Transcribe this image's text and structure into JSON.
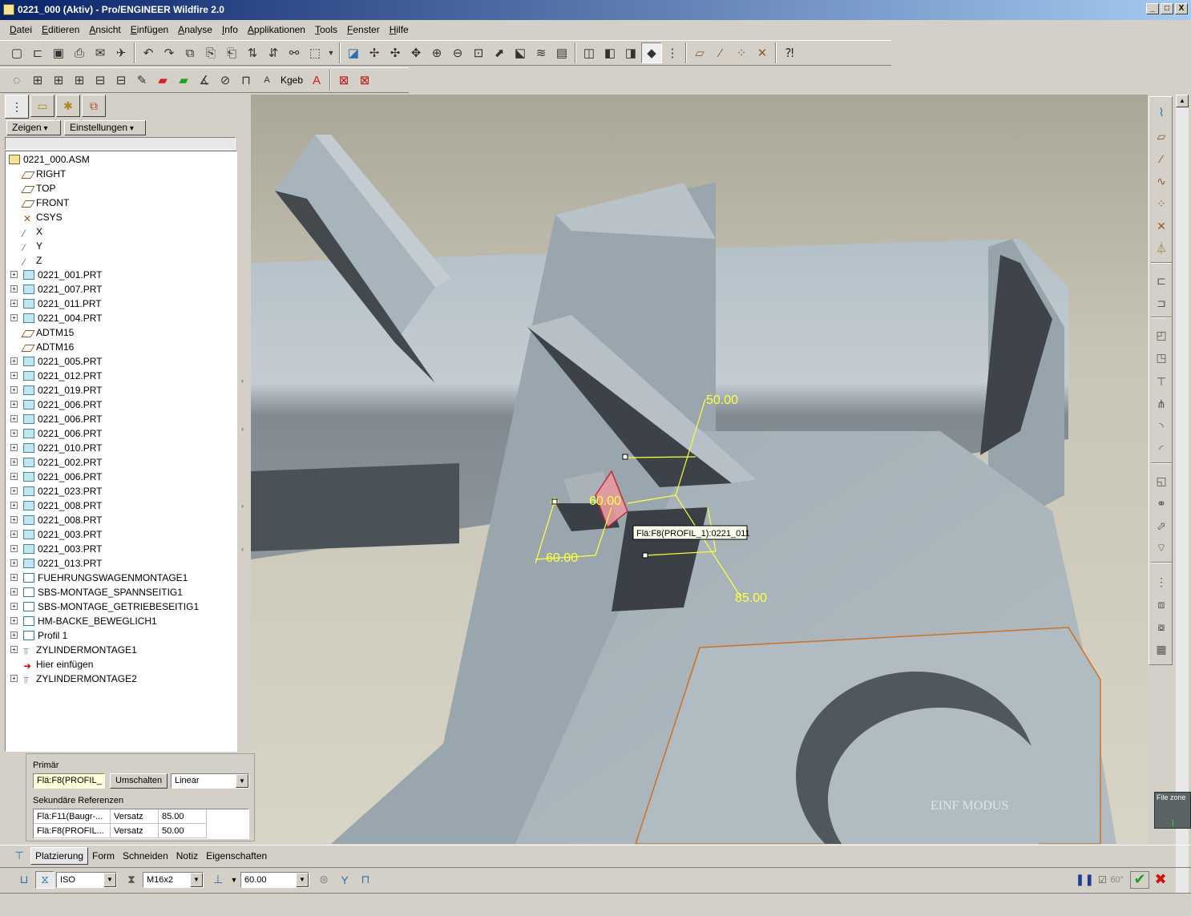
{
  "window": {
    "title": "0221_000 (Aktiv) - Pro/ENGINEER Wildfire 2.0",
    "buttons": [
      "_",
      "□",
      "X"
    ]
  },
  "menu": [
    "Datei",
    "Editieren",
    "Ansicht",
    "Einfügen",
    "Analyse",
    "Info",
    "Applikationen",
    "Tools",
    "Fenster",
    "Hilfe"
  ],
  "toolbar2": {
    "kgeb_label": "Kgeb"
  },
  "panel": {
    "show_button": "Zeigen",
    "settings_button": "Einstellungen"
  },
  "tree": [
    {
      "label": "0221_000.ASM",
      "type": "asm",
      "expand": false
    },
    {
      "label": "RIGHT",
      "type": "datum",
      "expand": false
    },
    {
      "label": "TOP",
      "type": "datum",
      "expand": false
    },
    {
      "label": "FRONT",
      "type": "datum",
      "expand": false
    },
    {
      "label": "CSYS",
      "type": "csys",
      "expand": false
    },
    {
      "label": "X",
      "type": "axis",
      "expand": false
    },
    {
      "label": "Y",
      "type": "axis",
      "expand": false
    },
    {
      "label": "Z",
      "type": "axis",
      "expand": false
    },
    {
      "label": "0221_001.PRT",
      "type": "prt",
      "expand": true
    },
    {
      "label": "0221_007.PRT",
      "type": "prt",
      "expand": true
    },
    {
      "label": "0221_011.PRT",
      "type": "prt",
      "expand": true
    },
    {
      "label": "0221_004.PRT",
      "type": "prt",
      "expand": true
    },
    {
      "label": "ADTM15",
      "type": "datum",
      "expand": false
    },
    {
      "label": "ADTM16",
      "type": "datum",
      "expand": false
    },
    {
      "label": "0221_005.PRT",
      "type": "prt",
      "expand": true
    },
    {
      "label": "0221_012.PRT",
      "type": "prt",
      "expand": true
    },
    {
      "label": "0221_019.PRT",
      "type": "prt",
      "expand": true
    },
    {
      "label": "0221_006.PRT",
      "type": "prt",
      "expand": true
    },
    {
      "label": "0221_006.PRT",
      "type": "prt",
      "expand": true
    },
    {
      "label": "0221_006.PRT",
      "type": "prt",
      "expand": true
    },
    {
      "label": "0221_010.PRT",
      "type": "prt",
      "expand": true
    },
    {
      "label": "0221_002.PRT",
      "type": "prt",
      "expand": true
    },
    {
      "label": "0221_006.PRT",
      "type": "prt",
      "expand": true
    },
    {
      "label": "0221_023.PRT",
      "type": "prt",
      "expand": true
    },
    {
      "label": "0221_008.PRT",
      "type": "prt",
      "expand": true
    },
    {
      "label": "0221_008.PRT",
      "type": "prt",
      "expand": true
    },
    {
      "label": "0221_003.PRT",
      "type": "prt",
      "expand": true
    },
    {
      "label": "0221_003.PRT",
      "type": "prt",
      "expand": true
    },
    {
      "label": "0221_013.PRT",
      "type": "prt",
      "expand": true
    },
    {
      "label": "FUEHRUNGSWAGENMONTAGE1",
      "type": "sub",
      "expand": true
    },
    {
      "label": "SBS-MONTAGE_SPANNSEITIG1",
      "type": "sub",
      "expand": true
    },
    {
      "label": "SBS-MONTAGE_GETRIEBESEITIG1",
      "type": "sub",
      "expand": true
    },
    {
      "label": "HM-BACKE_BEWEGLICH1",
      "type": "sub",
      "expand": true
    },
    {
      "label": "Profil 1",
      "type": "sub",
      "expand": true
    },
    {
      "label": "ZYLINDERMONTAGE1",
      "type": "cyl",
      "expand": true
    },
    {
      "label": "Hier einfügen",
      "type": "arrow",
      "expand": false
    },
    {
      "label": "ZYLINDERMONTAGE2",
      "type": "cyl2",
      "expand": true
    }
  ],
  "viewport": {
    "dims": [
      "50.00",
      "60.00",
      "85.00",
      "60.00"
    ],
    "tooltip": "Flä:F8(PROFIL_1):0221_011",
    "watermark": "EINF MODUS"
  },
  "placement": {
    "primary_label": "Primär",
    "primary_value": "Flä:F8(PROFIL_",
    "switch_button": "Umschalten",
    "type_value": "Linear",
    "secondary_label": "Sekundäre Referenzen",
    "refs": [
      {
        "ref": "Flä:F11(Baugr-...",
        "kind": "Versatz",
        "value": "85.00"
      },
      {
        "ref": "Flä:F8(PROFIL...",
        "kind": "Versatz",
        "value": "50.00"
      }
    ]
  },
  "dashboard": {
    "tabs": [
      "Platzierung",
      "Form",
      "Schneiden",
      "Notiz",
      "Eigenschaften"
    ],
    "standard": "ISO",
    "thread": "M16x2",
    "depth": "60.00",
    "preview_label": "60°"
  },
  "filezone_label": "File zone"
}
